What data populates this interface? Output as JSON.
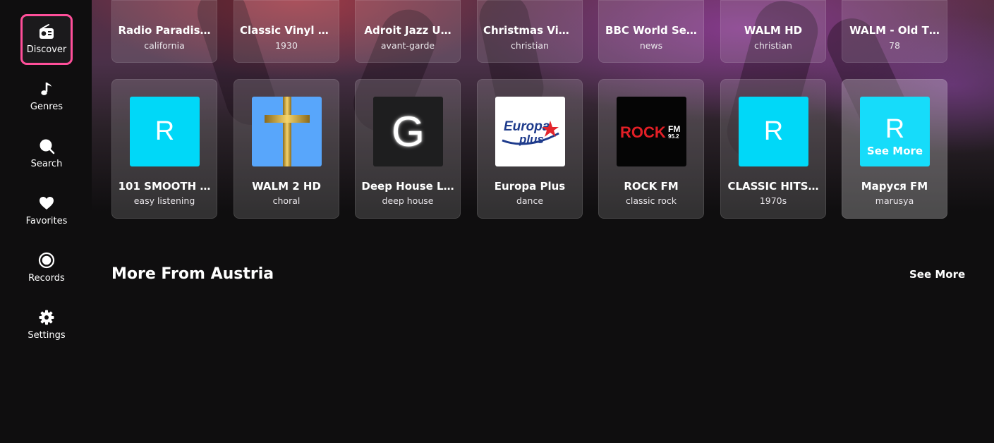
{
  "sidebar": {
    "items": [
      {
        "label": "Discover",
        "icon": "radio-icon",
        "active": true
      },
      {
        "label": "Genres",
        "icon": "music-note-icon"
      },
      {
        "label": "Search",
        "icon": "search-icon"
      },
      {
        "label": "Favorites",
        "icon": "heart-icon"
      },
      {
        "label": "Records",
        "icon": "record-icon"
      },
      {
        "label": "Settings",
        "icon": "gear-icon"
      }
    ]
  },
  "top_row": [
    {
      "title": "Radio Paradis…",
      "sub": "california"
    },
    {
      "title": "Classic Vinyl HD",
      "sub": "1930"
    },
    {
      "title": "Adroit Jazz U…",
      "sub": "avant-garde"
    },
    {
      "title": "Christmas Vin…",
      "sub": "christian"
    },
    {
      "title": "BBC World Se…",
      "sub": "news"
    },
    {
      "title": "WALM HD",
      "sub": "christian"
    },
    {
      "title": "WALM - Old T…",
      "sub": "78"
    }
  ],
  "stations": [
    {
      "title": "101 SMOOTH …",
      "sub": "easy listening",
      "logo_letter": "R",
      "logo_color": "#00d8f8"
    },
    {
      "title": "WALM 2 HD",
      "sub": "choral",
      "logo_color": "#58a6fb",
      "logo_icon": "golden-cross-icon"
    },
    {
      "title": "Deep House L…",
      "sub": "deep house",
      "logo_letter": "G",
      "logo_color": "#1e1e1f"
    },
    {
      "title": "Europa Plus",
      "sub": "dance",
      "logo_text_1": "Europa",
      "logo_text_2": "plus",
      "logo_color": "#ffffff"
    },
    {
      "title": "ROCK FM",
      "sub": "classic rock",
      "logo_text_1": "ROCK",
      "logo_text_2": "FM",
      "logo_text_3": "95.2",
      "logo_color": "#050505"
    },
    {
      "title": "CLASSIC HITS…",
      "sub": "1970s",
      "logo_letter": "R",
      "logo_color": "#00d8f8"
    },
    {
      "title": "Маруся FM",
      "sub": "marusya",
      "logo_letter": "R",
      "logo_color": "#16dcfa",
      "overlay": "See More"
    }
  ],
  "section": {
    "title": "More From Austria",
    "see_more": "See More"
  }
}
